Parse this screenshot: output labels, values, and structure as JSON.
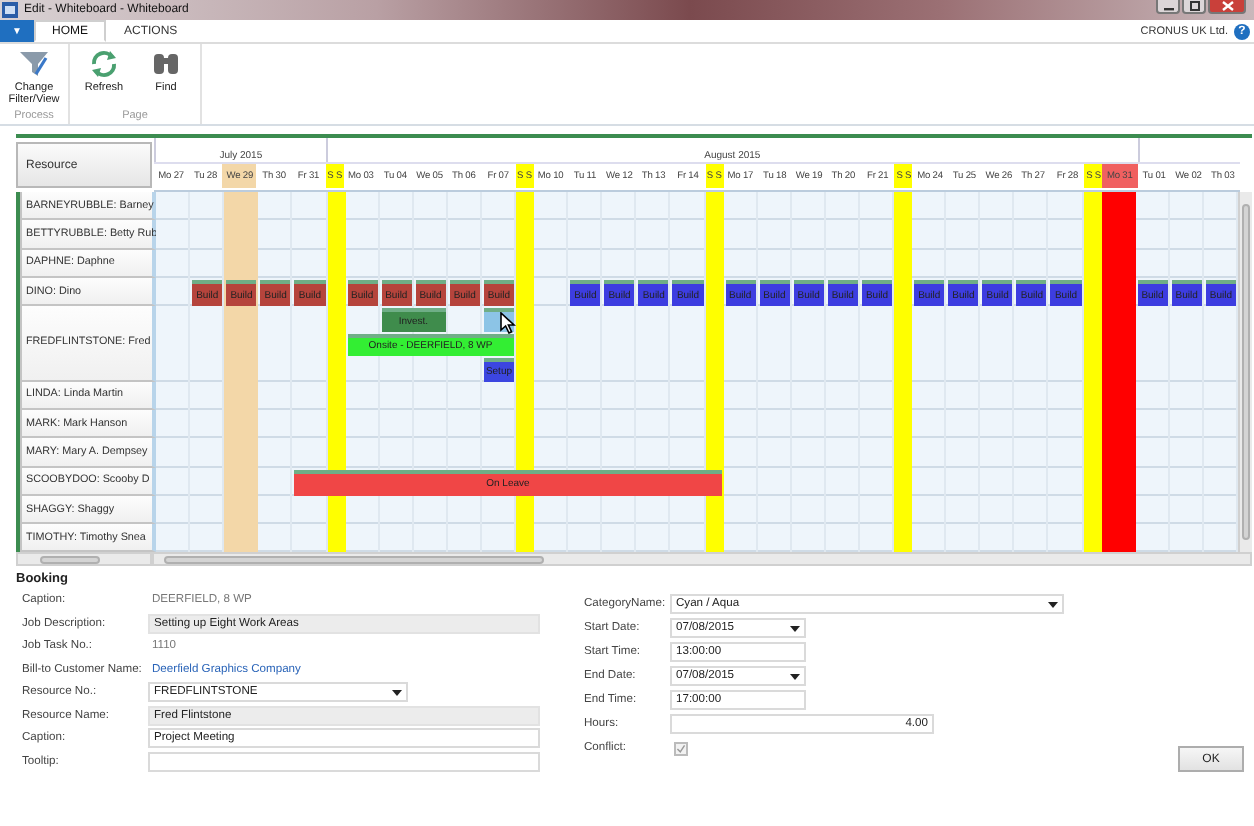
{
  "window": {
    "title": "Edit - Whiteboard - Whiteboard"
  },
  "menu_button": {
    "label": "▼"
  },
  "tabs": [
    {
      "label": "HOME",
      "selected": true
    },
    {
      "label": "ACTIONS",
      "selected": false
    }
  ],
  "company": "CRONUS UK Ltd.",
  "help": "?",
  "ribbon": [
    {
      "label": "Process",
      "buttons": [
        {
          "label": "Change Filter/View",
          "kind": "filter"
        }
      ]
    },
    {
      "label": "Page",
      "buttons": [
        {
          "label": "Refresh",
          "kind": "refresh"
        },
        {
          "label": "Find",
          "kind": "find"
        }
      ]
    }
  ],
  "calendar": {
    "resource_header": "Resource",
    "days": [
      {
        "label": "Mo 27",
        "kind": "weekday",
        "month": "July 2015"
      },
      {
        "label": "Tu 28",
        "kind": "weekday"
      },
      {
        "label": "We 29",
        "kind": "today"
      },
      {
        "label": "Th 30",
        "kind": "weekday"
      },
      {
        "label": "Fr 31",
        "kind": "weekday"
      },
      {
        "label": "S S",
        "kind": "weekend",
        "month": "August 2015"
      },
      {
        "label": "Mo 03",
        "kind": "weekday"
      },
      {
        "label": "Tu 04",
        "kind": "weekday"
      },
      {
        "label": "We 05",
        "kind": "weekday"
      },
      {
        "label": "Th 06",
        "kind": "weekday"
      },
      {
        "label": "Fr 07",
        "kind": "weekday"
      },
      {
        "label": "S S",
        "kind": "weekend"
      },
      {
        "label": "Mo 10",
        "kind": "weekday"
      },
      {
        "label": "Tu 11",
        "kind": "weekday"
      },
      {
        "label": "We 12",
        "kind": "weekday"
      },
      {
        "label": "Th 13",
        "kind": "weekday"
      },
      {
        "label": "Fr 14",
        "kind": "weekday"
      },
      {
        "label": "S S",
        "kind": "weekend"
      },
      {
        "label": "Mo 17",
        "kind": "weekday"
      },
      {
        "label": "Tu 18",
        "kind": "weekday"
      },
      {
        "label": "We 19",
        "kind": "weekday"
      },
      {
        "label": "Th 20",
        "kind": "weekday"
      },
      {
        "label": "Fr 21",
        "kind": "weekday"
      },
      {
        "label": "S S",
        "kind": "weekend"
      },
      {
        "label": "Mo 24",
        "kind": "weekday"
      },
      {
        "label": "Tu 25",
        "kind": "weekday"
      },
      {
        "label": "We 26",
        "kind": "weekday"
      },
      {
        "label": "Th 27",
        "kind": "weekday"
      },
      {
        "label": "Fr 28",
        "kind": "weekday"
      },
      {
        "label": "S S",
        "kind": "weekend"
      },
      {
        "label": "Mo 31",
        "kind": "blocked"
      },
      {
        "label": "Tu 01",
        "kind": "weekday",
        "new_month": true
      },
      {
        "label": "We 02",
        "kind": "weekday"
      },
      {
        "label": "Th 03",
        "kind": "weekday"
      }
    ],
    "resources": [
      {
        "label": "BARNEYRUBBLE: Barney"
      },
      {
        "label": "BETTYRUBBLE: Betty Rub"
      },
      {
        "label": "DAPHNE: Daphne"
      },
      {
        "label": "DINO: Dino",
        "lanes": [
          [
            {
              "kind": "empty"
            },
            {
              "kind": "booking",
              "label": "Build",
              "color": "#b5443c"
            },
            {
              "kind": "booking",
              "label": "Build",
              "color": "#b5443c"
            },
            {
              "kind": "booking",
              "label": "Build",
              "color": "#b5443c"
            },
            {
              "kind": "booking",
              "label": "Build",
              "color": "#b5443c"
            },
            {
              "kind": "empty"
            },
            {
              "kind": "booking",
              "label": "Build",
              "color": "#b5443c"
            },
            {
              "kind": "booking",
              "label": "Build",
              "color": "#b5443c"
            },
            {
              "kind": "booking",
              "label": "Build",
              "color": "#b5443c"
            },
            {
              "kind": "booking",
              "label": "Build",
              "color": "#b5443c"
            },
            {
              "kind": "booking",
              "label": "Build",
              "color": "#b5443c"
            },
            {
              "kind": "empty"
            },
            {
              "kind": "empty"
            },
            {
              "kind": "booking",
              "label": "Build",
              "color": "#3d3de0"
            },
            {
              "kind": "booking",
              "label": "Build",
              "color": "#3d3de0"
            },
            {
              "kind": "booking",
              "label": "Build",
              "color": "#3d3de0"
            },
            {
              "kind": "booking",
              "label": "Build",
              "color": "#3d3de0"
            },
            {
              "kind": "empty"
            },
            {
              "kind": "booking",
              "label": "Build",
              "color": "#3d3de0"
            },
            {
              "kind": "booking",
              "label": "Build",
              "color": "#3d3de0"
            },
            {
              "kind": "booking",
              "label": "Build",
              "color": "#3d3de0"
            },
            {
              "kind": "booking",
              "label": "Build",
              "color": "#3d3de0"
            },
            {
              "kind": "booking",
              "label": "Build",
              "color": "#3d3de0"
            },
            {
              "kind": "empty"
            },
            {
              "kind": "booking",
              "label": "Build",
              "color": "#3d3de0"
            },
            {
              "kind": "booking",
              "label": "Build",
              "color": "#3d3de0"
            },
            {
              "kind": "booking",
              "label": "Build",
              "color": "#3d3de0"
            },
            {
              "kind": "booking",
              "label": "Build",
              "color": "#3d3de0"
            },
            {
              "kind": "booking",
              "label": "Build",
              "color": "#3d3de0"
            },
            {
              "kind": "empty"
            },
            {
              "kind": "empty"
            },
            {
              "kind": "booking",
              "label": "Build",
              "color": "#3d3de0"
            },
            {
              "kind": "booking",
              "label": "Build",
              "color": "#3d3de0"
            },
            {
              "kind": "booking",
              "label": "Build",
              "color": "#3d3de0"
            }
          ]
        ]
      },
      {
        "label": "FREDFLINTSTONE: Fred",
        "lanes": [
          [
            {
              "kind": "empty"
            },
            {
              "kind": "empty"
            },
            {
              "kind": "empty"
            },
            {
              "kind": "empty"
            },
            {
              "kind": "empty"
            },
            {
              "kind": "empty"
            },
            {
              "kind": "empty"
            },
            {
              "kind": "booking",
              "label": "Invest.",
              "color": "#3f8c4c"
            },
            {
              "kind": "continued"
            },
            {
              "kind": "empty"
            },
            {
              "kind": "booking",
              "color": "#8cc4e6"
            },
            {
              "kind": "empty"
            },
            {
              "kind": "empty"
            },
            {
              "kind": "empty"
            },
            {
              "kind": "empty"
            },
            {
              "kind": "empty"
            },
            {
              "kind": "empty"
            },
            {
              "kind": "empty"
            },
            {
              "kind": "empty"
            },
            {
              "kind": "empty"
            },
            {
              "kind": "empty"
            },
            {
              "kind": "empty"
            },
            {
              "kind": "empty"
            },
            {
              "kind": "empty"
            },
            {
              "kind": "empty"
            },
            {
              "kind": "empty"
            },
            {
              "kind": "empty"
            },
            {
              "kind": "empty"
            },
            {
              "kind": "empty"
            },
            {
              "kind": "empty"
            },
            {
              "kind": "empty"
            },
            {
              "kind": "empty"
            },
            {
              "kind": "empty"
            },
            {
              "kind": "empty"
            }
          ],
          [
            {
              "kind": "empty"
            },
            {
              "kind": "empty"
            },
            {
              "kind": "empty"
            },
            {
              "kind": "empty"
            },
            {
              "kind": "empty"
            },
            {
              "kind": "empty"
            },
            {
              "kind": "booking",
              "label": "Onsite - DEERFIELD, 8 WP",
              "color": "#33ee33"
            },
            {
              "kind": "continued"
            },
            {
              "kind": "continued"
            },
            {
              "kind": "continued"
            },
            {
              "kind": "continued"
            },
            {
              "kind": "empty"
            },
            {
              "kind": "empty"
            },
            {
              "kind": "empty"
            },
            {
              "kind": "empty"
            },
            {
              "kind": "empty"
            },
            {
              "kind": "empty"
            },
            {
              "kind": "empty"
            },
            {
              "kind": "empty"
            },
            {
              "kind": "empty"
            },
            {
              "kind": "empty"
            },
            {
              "kind": "empty"
            },
            {
              "kind": "empty"
            },
            {
              "kind": "empty"
            },
            {
              "kind": "empty"
            },
            {
              "kind": "empty"
            },
            {
              "kind": "empty"
            },
            {
              "kind": "empty"
            },
            {
              "kind": "empty"
            },
            {
              "kind": "empty"
            },
            {
              "kind": "empty"
            },
            {
              "kind": "empty"
            },
            {
              "kind": "empty"
            },
            {
              "kind": "empty"
            }
          ],
          [
            {
              "kind": "empty"
            },
            {
              "kind": "empty"
            },
            {
              "kind": "empty"
            },
            {
              "kind": "empty"
            },
            {
              "kind": "empty"
            },
            {
              "kind": "empty"
            },
            {
              "kind": "empty"
            },
            {
              "kind": "empty"
            },
            {
              "kind": "empty"
            },
            {
              "kind": "empty"
            },
            {
              "kind": "booking",
              "label": "Setup",
              "color": "#3c46e0"
            },
            {
              "kind": "empty"
            },
            {
              "kind": "empty"
            },
            {
              "kind": "empty"
            },
            {
              "kind": "empty"
            },
            {
              "kind": "empty"
            },
            {
              "kind": "empty"
            },
            {
              "kind": "empty"
            },
            {
              "kind": "empty"
            },
            {
              "kind": "empty"
            },
            {
              "kind": "empty"
            },
            {
              "kind": "empty"
            },
            {
              "kind": "empty"
            },
            {
              "kind": "empty"
            },
            {
              "kind": "empty"
            },
            {
              "kind": "empty"
            },
            {
              "kind": "empty"
            },
            {
              "kind": "empty"
            },
            {
              "kind": "empty"
            },
            {
              "kind": "empty"
            },
            {
              "kind": "empty"
            },
            {
              "kind": "empty"
            },
            {
              "kind": "empty"
            },
            {
              "kind": "empty"
            }
          ]
        ]
      },
      {
        "label": "LINDA: Linda Martin"
      },
      {
        "label": "MARK: Mark Hanson"
      },
      {
        "label": "MARY: Mary A. Dempsey"
      },
      {
        "label": "SCOOBYDOO: Scooby D",
        "lanes": [
          [
            {
              "kind": "empty"
            },
            {
              "kind": "empty"
            },
            {
              "kind": "empty"
            },
            {
              "kind": "empty"
            },
            {
              "kind": "booking",
              "label": "On Leave",
              "color": "#f04646"
            },
            {
              "kind": "continued"
            },
            {
              "kind": "continued"
            },
            {
              "kind": "continued"
            },
            {
              "kind": "continued"
            },
            {
              "kind": "continued"
            },
            {
              "kind": "continued"
            },
            {
              "kind": "continued"
            },
            {
              "kind": "continued"
            },
            {
              "kind": "continued"
            },
            {
              "kind": "continued"
            },
            {
              "kind": "continued"
            },
            {
              "kind": "continued"
            },
            {
              "kind": "continued"
            },
            {
              "kind": "empty"
            },
            {
              "kind": "empty"
            },
            {
              "kind": "empty"
            },
            {
              "kind": "empty"
            },
            {
              "kind": "empty"
            },
            {
              "kind": "empty"
            },
            {
              "kind": "empty"
            },
            {
              "kind": "empty"
            },
            {
              "kind": "empty"
            },
            {
              "kind": "empty"
            },
            {
              "kind": "empty"
            },
            {
              "kind": "empty"
            },
            {
              "kind": "empty"
            },
            {
              "kind": "empty"
            },
            {
              "kind": "empty"
            },
            {
              "kind": "empty"
            }
          ]
        ]
      },
      {
        "label": "SHAGGY: Shaggy"
      },
      {
        "label": "TIMOTHY: Timothy Snea"
      }
    ]
  },
  "booking": {
    "title": "Booking",
    "left_fields": [
      {
        "label": "Caption:",
        "value": "DEERFIELD, 8 WP",
        "kind": "text"
      },
      {
        "label": "Job Description:",
        "value": "Setting up Eight Work Areas",
        "kind": "readonly"
      },
      {
        "label": "Job Task No.:",
        "value": "1110",
        "kind": "text"
      },
      {
        "label": "Bill-to Customer Name:",
        "value": "Deerfield Graphics Company",
        "kind": "link"
      },
      {
        "label": "Resource No.:",
        "value": "FREDFLINTSTONE",
        "kind": "dropdown"
      },
      {
        "label": "Resource Name:",
        "value": "Fred  Flintstone",
        "kind": "readonly"
      },
      {
        "label": "Caption:",
        "value": "Project Meeting",
        "kind": "input"
      },
      {
        "label": "Tooltip:",
        "kind": "input"
      }
    ],
    "right_fields": [
      {
        "label": "CategoryName:",
        "value": "Cyan / Aqua",
        "kind": "dropdown"
      },
      {
        "label": "Start Date:",
        "value": "07/08/2015",
        "kind": "date"
      },
      {
        "label": "Start Time:",
        "value": "13:00:00",
        "kind": "time"
      },
      {
        "label": "End Date:",
        "value": "07/08/2015",
        "kind": "date"
      },
      {
        "label": "End Time:",
        "value": "17:00:00",
        "kind": "time"
      },
      {
        "label": "Hours:",
        "value": "4.00",
        "kind": "number"
      },
      {
        "label": "Conflict:",
        "kind": "checkbox",
        "checked": true,
        "disabled": true
      }
    ]
  },
  "ok_button": "OK"
}
